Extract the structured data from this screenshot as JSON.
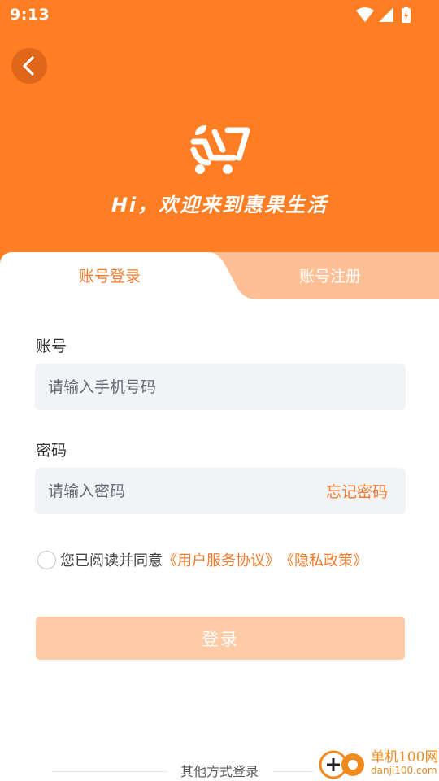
{
  "status_bar": {
    "time": "9:13",
    "icons": [
      "wifi-icon",
      "signal-icon",
      "battery-charging-icon"
    ]
  },
  "header": {
    "back_icon": "chevron-left-icon",
    "logo_icon": "leaf-cart-logo",
    "welcome": "Hi，欢迎来到惠果生活",
    "background_color": "#ff7d23"
  },
  "tabs": [
    {
      "label": "账号登录",
      "active": true
    },
    {
      "label": "账号注册",
      "active": false
    }
  ],
  "form": {
    "account_label": "账号",
    "account_placeholder": "请输入手机号码",
    "password_label": "密码",
    "password_placeholder": "请输入密码",
    "forgot_password": "忘记密码"
  },
  "agreement": {
    "checked": false,
    "prefix": "您已阅读并同意",
    "user_agreement": "《用户服务协议》",
    "privacy_policy": "《隐私政策》"
  },
  "login_button": "登录",
  "other_login": "其他方式登录",
  "watermark": {
    "line1": "单机100网",
    "line2": "danji100.com"
  },
  "colors": {
    "accent": "#f27a2a",
    "tab_inactive": "#ffbf95",
    "button_disabled": "#ffcaa6",
    "input_bg": "#f1f3f6"
  }
}
